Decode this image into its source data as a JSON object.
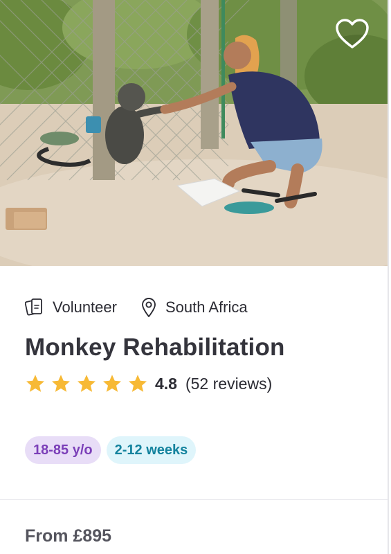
{
  "card": {
    "hero": {
      "icon": "heart-outline-icon",
      "alt": ""
    },
    "meta": {
      "category": {
        "icon": "volunteer-card-icon",
        "label": "Volunteer"
      },
      "location": {
        "icon": "location-pin-icon",
        "label": "South Africa"
      }
    },
    "title": "Monkey Rehabilitation",
    "rating": {
      "value": "4.8",
      "reviews": "(52 reviews)",
      "stars_filled": 5,
      "stars_total": 5,
      "star_color": "#f7b935"
    },
    "tags": [
      {
        "label": "18-85 y/o",
        "bg": "#e8ddf7",
        "color": "#7b3fb8"
      },
      {
        "label": "2-12 weeks",
        "bg": "#dff5fb",
        "color": "#14839e"
      }
    ],
    "price": "From £895"
  }
}
